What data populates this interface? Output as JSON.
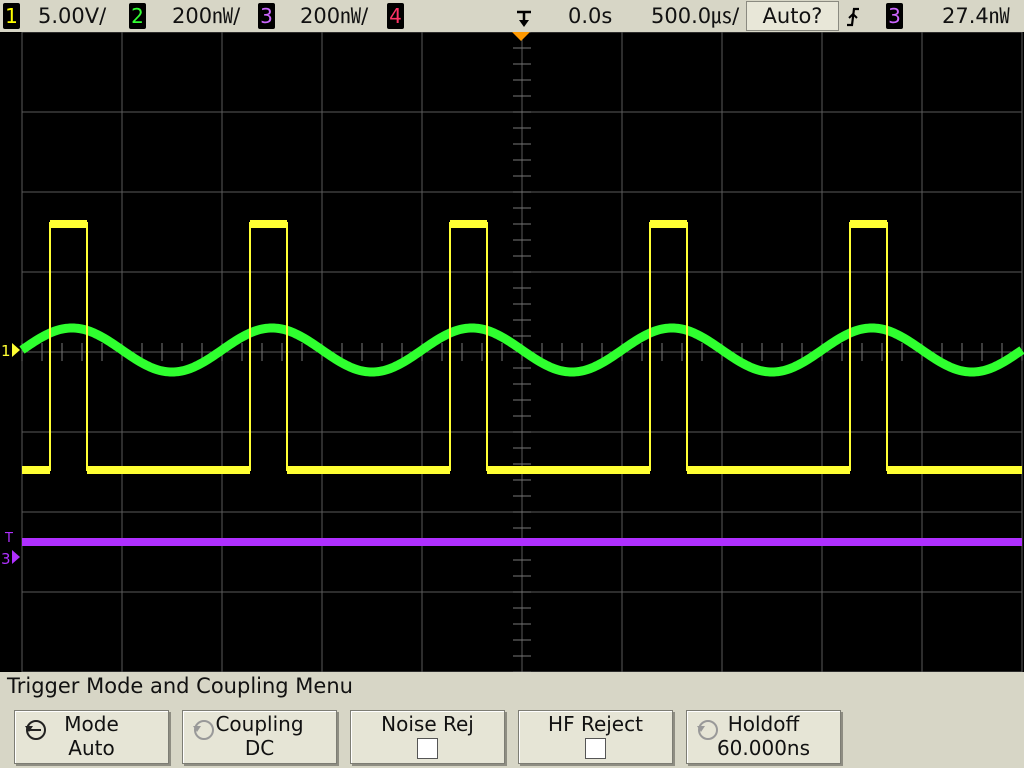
{
  "top_bar": {
    "ch1": {
      "num": "1",
      "scale": "5.00V/",
      "color": "#ffff00"
    },
    "ch2": {
      "num": "2",
      "scale": "200㎻/",
      "color": "#33ff33"
    },
    "ch3": {
      "num": "3",
      "scale": "200㎻/",
      "color": "#cc66ff"
    },
    "ch4": {
      "num": "4",
      "color": "#ff3366"
    },
    "delay": "0.0s",
    "timebase": "500.0㎲/",
    "run_mode": "Auto?",
    "trigger_slope_icon": "rising-edge-icon",
    "trigger_source": "3",
    "trigger_level": "27.4㎻"
  },
  "screen": {
    "ch1_marker": "1",
    "ch3_marker": "3",
    "trigger_level_marker": "T",
    "colors": {
      "grid": "#5a5a5a",
      "ch1": "#ffff33",
      "ch2": "#2fff2f",
      "ch3": "#b030ff",
      "trigger": "#ff9900"
    }
  },
  "menu": {
    "title": "Trigger Mode and Coupling Menu",
    "softkeys": [
      {
        "label": "Mode",
        "value": "Auto",
        "icon": "rotate-arrow-icon"
      },
      {
        "label": "Coupling",
        "value": "DC",
        "icon": "rotate-arrow-icon"
      },
      {
        "label": "Noise Rej",
        "checked": false
      },
      {
        "label": "HF Reject",
        "checked": false
      },
      {
        "label": "Holdoff",
        "value": "60.000ns",
        "icon": "rotate-arrow-icon"
      }
    ]
  }
}
